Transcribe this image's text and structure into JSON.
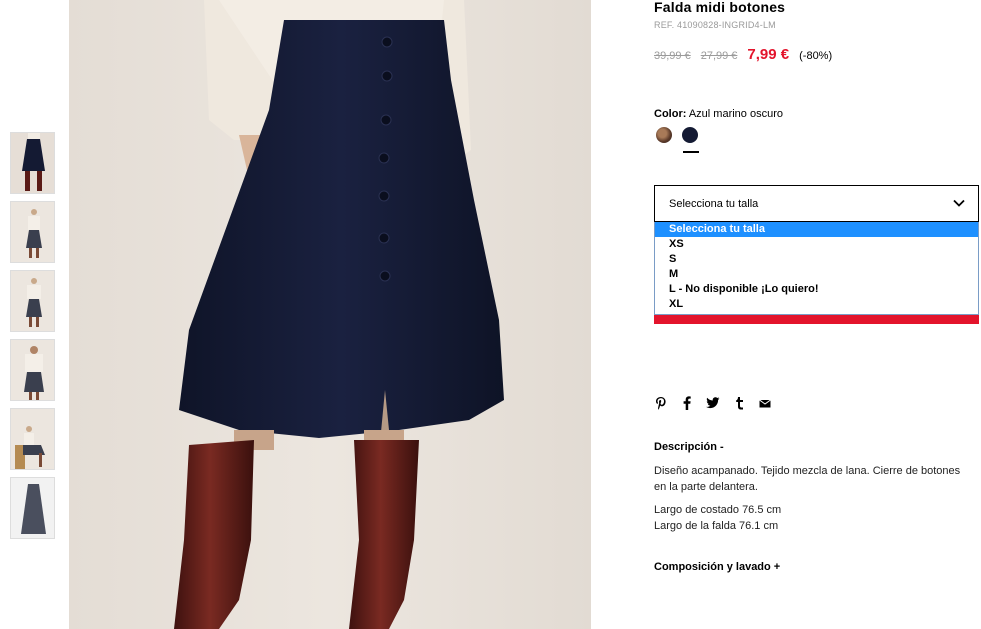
{
  "product": {
    "title": "Falda midi botones",
    "ref": "REF. 41090828-INGRID4-LM",
    "price_original": "39,99 €",
    "price_previous": "27,99 €",
    "price_current": "7,99 €",
    "discount": "(-80%)"
  },
  "color": {
    "label": "Color:",
    "value": "Azul marino oscuro",
    "swatches": [
      {
        "name": "brown-pattern",
        "color": "#5b3a2a"
      },
      {
        "name": "navy",
        "color": "#141a33",
        "selected": true
      }
    ]
  },
  "size_select": {
    "value": "Selecciona tu talla",
    "options": [
      "Selecciona tu talla",
      "XS",
      "S",
      "M",
      "L - No disponible ¡Lo quiero!",
      "XL"
    ]
  },
  "share_icons": [
    "pinterest-icon",
    "facebook-icon",
    "twitter-icon",
    "tumblr-icon",
    "email-icon"
  ],
  "description": {
    "heading": "Descripción -",
    "text": "Diseño acampanado. Tejido mezcla de lana. Cierre de botones en la parte delantera.",
    "line1": "Largo de costado 76.5 cm",
    "line2": "Largo de la falda 76.1 cm"
  },
  "composition": {
    "heading": "Composición y lavado +"
  },
  "colors": {
    "accent_red": "#e3142c",
    "dropdown_highlight": "#1e90ff",
    "skirt": "#141a33",
    "boots": "#5a1a16"
  }
}
